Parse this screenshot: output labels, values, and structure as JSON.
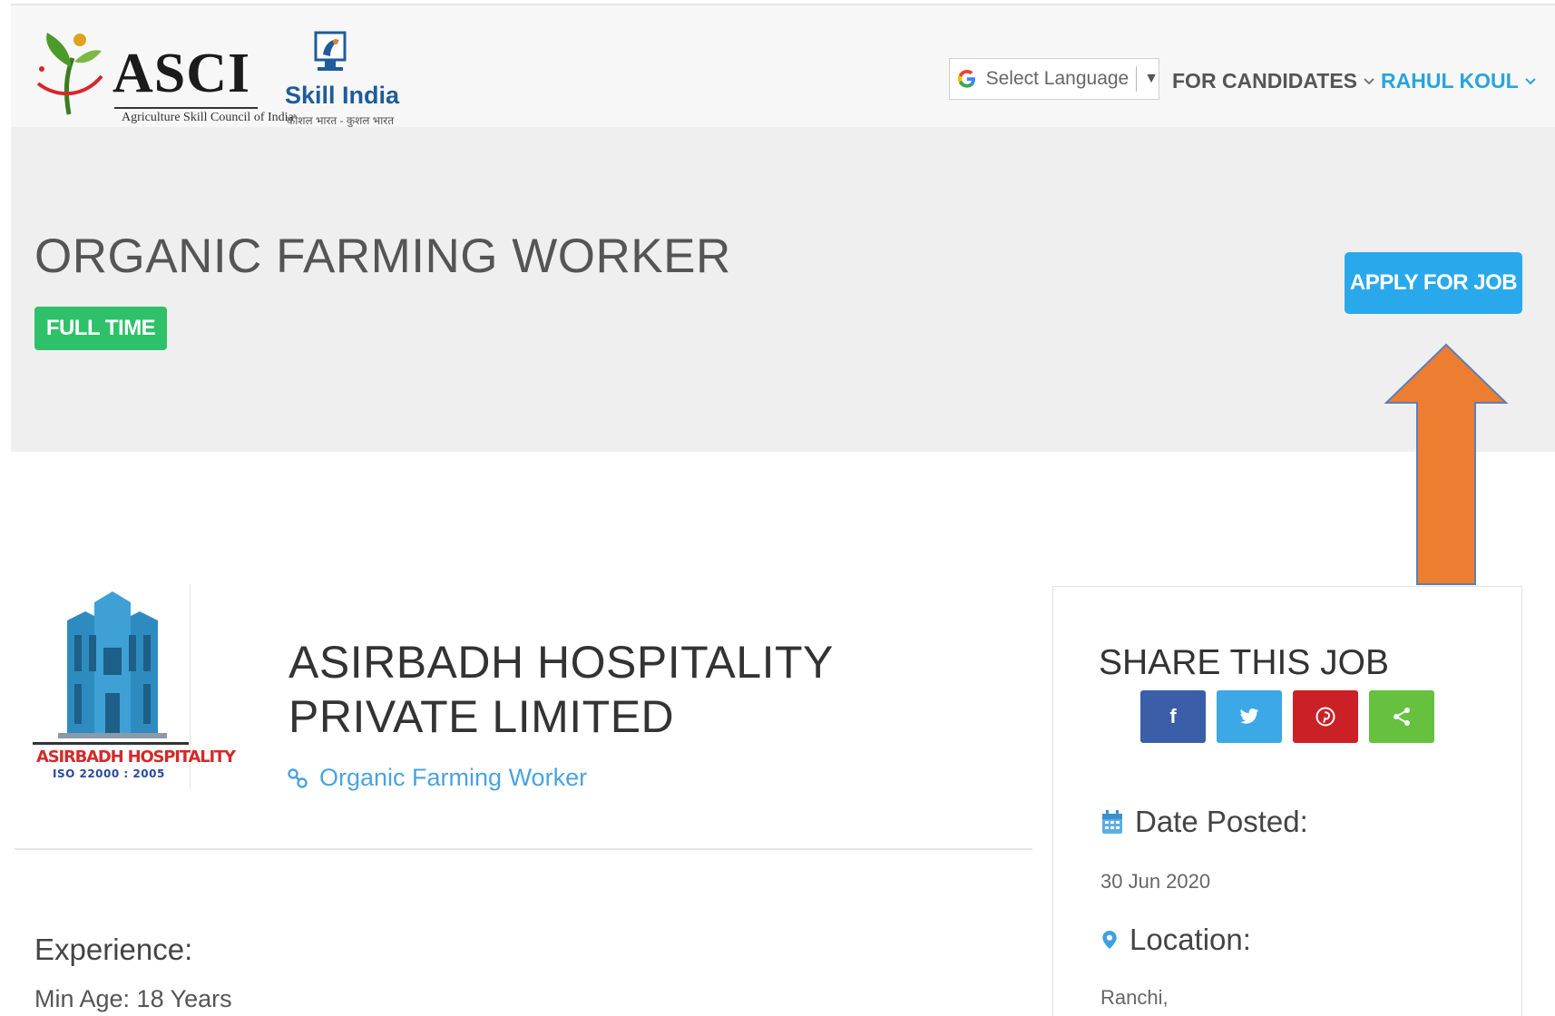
{
  "header": {
    "asci_logo_text": "ASCI",
    "asci_tagline": "Agriculture Skill Council of India",
    "skill_india_title": "Skill India",
    "skill_india_tagline": "कौशल भारत - कुशल भारत",
    "language_select": "Select Language",
    "nav_candidates": "FOR CANDIDATES",
    "nav_user": "RAHUL KOUL"
  },
  "job": {
    "title": "ORGANIC FARMING WORKER",
    "type_badge": "FULL TIME",
    "apply_label": "APPLY FOR JOB"
  },
  "company": {
    "logo_name": "ASIRBADH HOSPITALITY",
    "logo_iso": "ISO 22000 : 2005",
    "name": "ASIRBADH HOSPITALITY PRIVATE LIMITED",
    "category": "Organic Farming Worker"
  },
  "details": {
    "experience_label": "Experience:",
    "min_age": "Min Age: 18 Years"
  },
  "sidebar": {
    "share_title": "SHARE THIS JOB",
    "share_buttons": [
      {
        "icon": "facebook-icon",
        "glyph": "f",
        "color": "#3b5ea8"
      },
      {
        "icon": "twitter-icon",
        "glyph": "t",
        "color": "#3ca8e6"
      },
      {
        "icon": "pinterest-icon",
        "glyph": "p",
        "color": "#cc2027"
      },
      {
        "icon": "share-icon",
        "glyph": "<",
        "color": "#66c13e"
      }
    ],
    "date_posted_label": "Date Posted:",
    "date_posted_value": "30 Jun 2020",
    "location_label": "Location:",
    "location_value": "Ranchi,"
  },
  "colors": {
    "accent": "#29a9ec",
    "badge_green": "#2ec16a",
    "annotation_arrow": "#ed7d31"
  }
}
